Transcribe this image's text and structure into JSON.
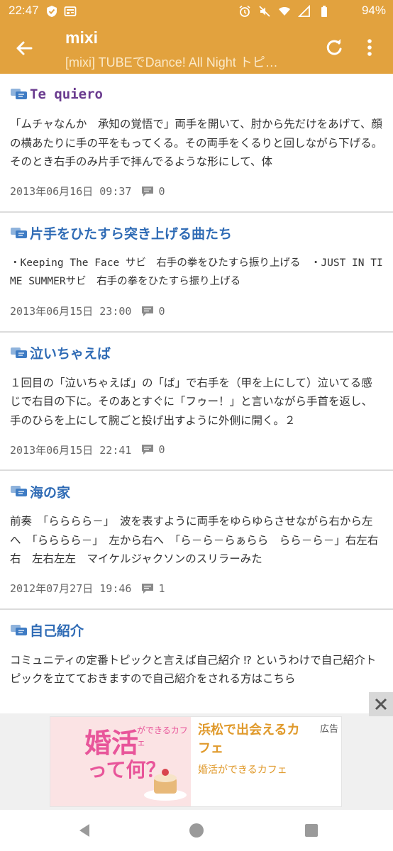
{
  "statusbar": {
    "time": "22:47",
    "battery": "94%",
    "icons": [
      "shield-check-icon",
      "news-icon",
      "alarm-icon",
      "mute-icon",
      "wifi-icon",
      "signal-icon",
      "battery-icon"
    ]
  },
  "appbar": {
    "title": "mixi",
    "subtitle": "[mixi] TUBEでDance! All Night トピ…",
    "back_icon": "arrow-left-icon",
    "refresh_icon": "refresh-icon",
    "more_icon": "more-vert-icon"
  },
  "colors": {
    "brand": "#e2a23e",
    "link": "#2f6bb5"
  },
  "topics": [
    {
      "title": "Te quiero",
      "body": "「ムチャなんか　承知の覚悟で」両手を開いて、肘から先だけをあげて、顔の横あたりに手の平をもってくる。その両手をくるりと回しながら下げる。そのとき右手のみ片手で拝んでるような形にして、体",
      "date": "2013年06月16日 09:37",
      "comments": "0"
    },
    {
      "title": "片手をひたすら突き上げる曲たち",
      "body": "・Keeping The Face サビ　右手の拳をひたすら振り上げる　・JUST IN TIME SUMMERサビ　右手の拳をひたすら振り上げる",
      "date": "2013年06月15日 23:00",
      "comments": "0"
    },
    {
      "title": "泣いちゃえば",
      "body": "１回目の「泣いちゃえば」の「ば」で右手を（甲を上にして）泣いてる感じで右目の下に。そのあとすぐに「フゥー！」と言いながら手首を返し、手のひらを上にして腕ごと投げ出すように外側に開く。２",
      "date": "2013年06月15日 22:41",
      "comments": "0"
    },
    {
      "title": "海の家",
      "body": "前奏　「らららら－」　波を表すように両手をゆらゆらさせながら右から左へ　「らららら－」　左から右へ　「ら－ら－らぁらら　らら－ら－」右左右右　左右左左　マイケルジャクソンのスリラーみた",
      "date": "2012年07月27日 19:46",
      "comments": "1"
    },
    {
      "title": "自己紹介",
      "body": "コミュニティの定番トピックと言えば自己紹介 ⁉ というわけで自己紹介トピックを立てておきますので自己紹介をされる方はこちら",
      "date": "",
      "comments": ""
    }
  ],
  "ad": {
    "big_text": "婚活",
    "small_tag": "ができるカフェ",
    "question": "って何？",
    "headline": "浜松で出会えるカフェ",
    "label": "広告",
    "description": "婚活ができるカフェ"
  },
  "navbar": {
    "icons": [
      "back-triangle-icon",
      "home-circle-icon",
      "recents-square-icon"
    ]
  }
}
